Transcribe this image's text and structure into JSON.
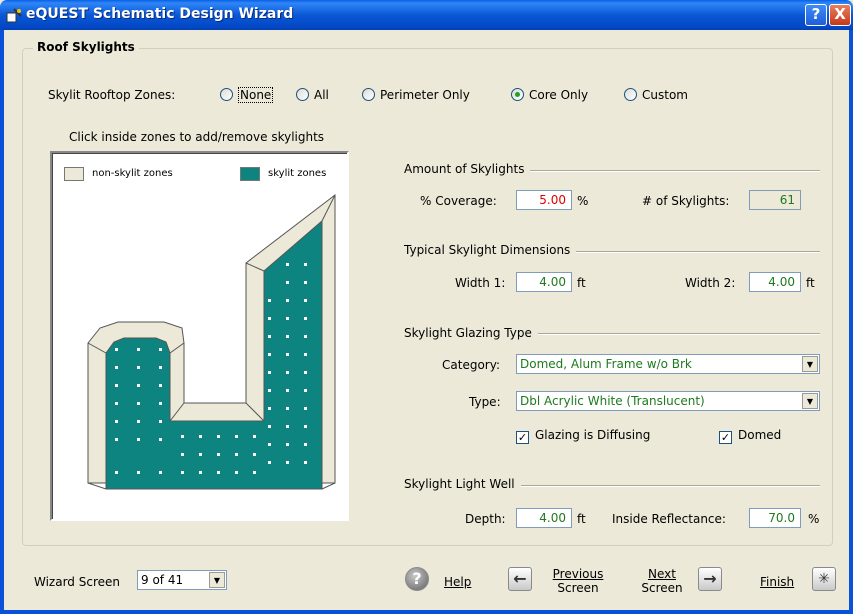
{
  "window": {
    "title": "eQUEST Schematic Design Wizard",
    "help_btn": "?",
    "close_btn": "X"
  },
  "group_title": "Roof Skylights",
  "zones": {
    "label": "Skylit Rooftop Zones:",
    "options": [
      "None",
      "All",
      "Perimeter Only",
      "Core Only",
      "Custom"
    ],
    "selected": "Core Only"
  },
  "canvas": {
    "hint": "Click inside zones to add/remove skylights",
    "legend_non_skylit": "non-skylit zones",
    "legend_skylit": "skylit zones",
    "colors": {
      "non_skylit": "#ECE9D8",
      "skylit": "#0E8481",
      "skylight_dot": "#FFFFFF"
    }
  },
  "amount": {
    "title": "Amount of Skylights",
    "coverage_label": "% Coverage:",
    "coverage_value": "5.00",
    "coverage_unit": "%",
    "count_label": "# of Skylights:",
    "count_value": "61"
  },
  "dimensions": {
    "title": "Typical Skylight Dimensions",
    "width1_label": "Width 1:",
    "width1_value": "4.00",
    "width1_unit": "ft",
    "width2_label": "Width 2:",
    "width2_value": "4.00",
    "width2_unit": "ft"
  },
  "glazing": {
    "title": "Skylight Glazing Type",
    "category_label": "Category:",
    "category_value": "Domed, Alum Frame w/o Brk",
    "type_label": "Type:",
    "type_value": "Dbl Acrylic White (Translucent)",
    "diffusing_label": "Glazing is Diffusing",
    "diffusing_checked": true,
    "domed_label": "Domed",
    "domed_checked": true
  },
  "lightwell": {
    "title": "Skylight Light Well",
    "depth_label": "Depth:",
    "depth_value": "4.00",
    "depth_unit": "ft",
    "reflectance_label": "Inside Reflectance:",
    "reflectance_value": "70.0",
    "reflectance_unit": "%"
  },
  "footer": {
    "wizard_label": "Wizard Screen",
    "wizard_value": "9 of 41",
    "help": "Help",
    "previous_line1": "Previous",
    "previous_line2": "Screen",
    "next_line1": "Next",
    "next_line2": "Screen",
    "finish": "Finish"
  }
}
